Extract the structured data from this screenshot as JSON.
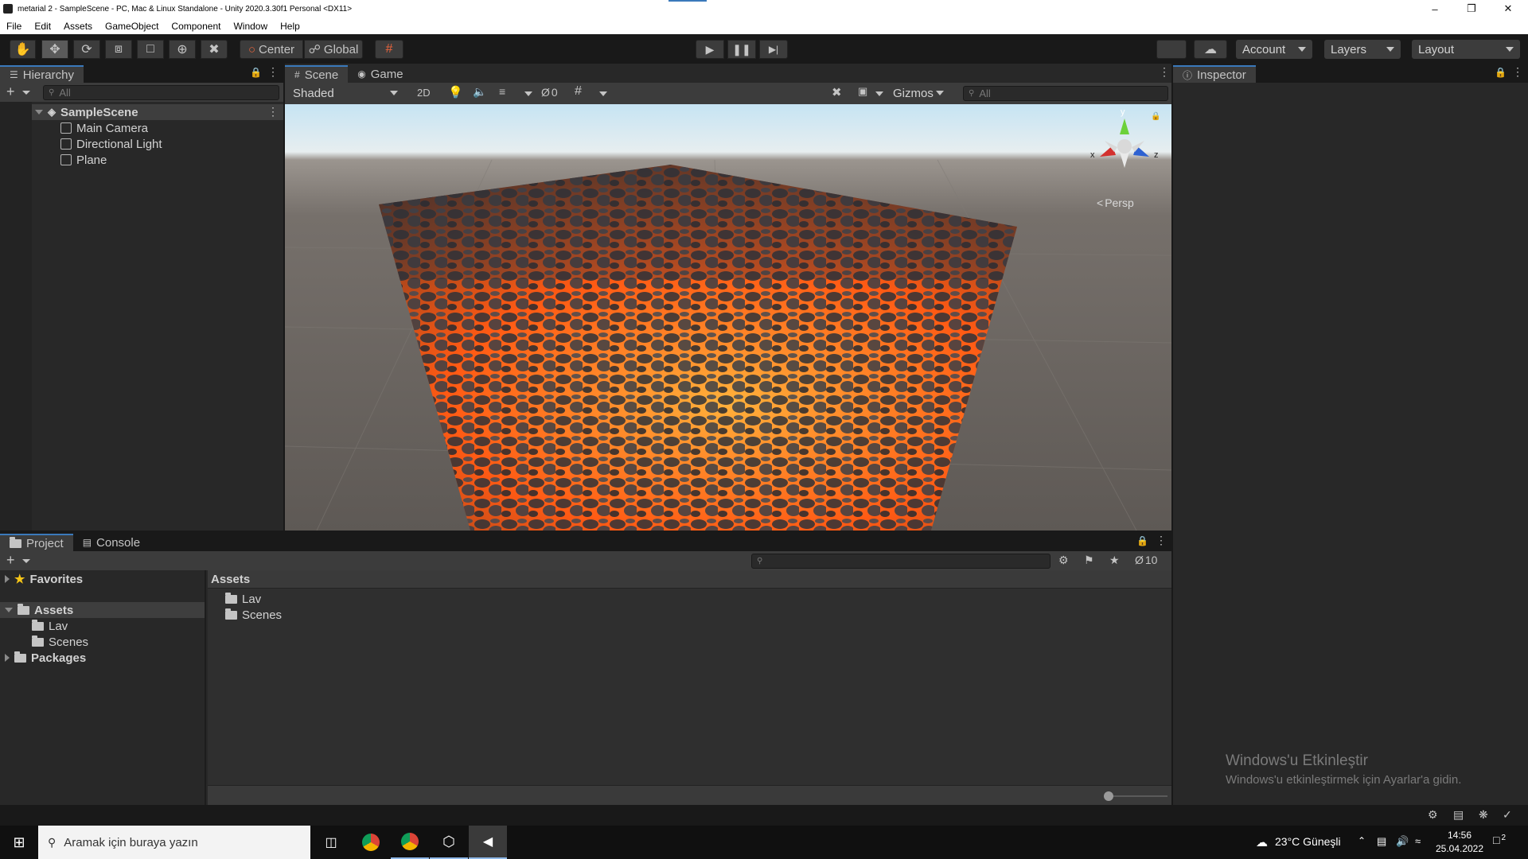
{
  "window": {
    "title": "metarial 2 - SampleScene - PC, Mac & Linux Standalone - Unity 2020.3.30f1 Personal <DX11>"
  },
  "menu": [
    "File",
    "Edit",
    "Assets",
    "GameObject",
    "Component",
    "Window",
    "Help"
  ],
  "toolbar": {
    "pivot_label": "Center",
    "space_label": "Global",
    "account_label": "Account",
    "layers_label": "Layers",
    "layout_label": "Layout"
  },
  "hierarchy": {
    "tab_label": "Hierarchy",
    "search_placeholder": "All",
    "scene_name": "SampleScene",
    "items": [
      "Main Camera",
      "Directional Light",
      "Plane"
    ]
  },
  "scene": {
    "tabs": [
      "Scene",
      "Game"
    ],
    "shading_mode": "Shaded",
    "mode_2d": "2D",
    "hidden_count": "0",
    "gizmos_label": "Gizmos",
    "search_placeholder": "All",
    "projection_label": "Persp",
    "axes": {
      "x": "x",
      "y": "y",
      "z": "z"
    }
  },
  "inspector": {
    "tab_label": "Inspector"
  },
  "project": {
    "tabs": [
      "Project",
      "Console"
    ],
    "hidden_count": "10",
    "tree": {
      "favorites": "Favorites",
      "assets": "Assets",
      "assets_children": [
        "Lav",
        "Scenes"
      ],
      "packages": "Packages"
    },
    "breadcrumb": "Assets",
    "grid_items": [
      "Lav",
      "Scenes"
    ],
    "zoom_slider": 0.0
  },
  "watermark": {
    "line1": "Windows'u Etkinleştir",
    "line2": "Windows'u etkinleştirmek için Ayarlar'a gidin."
  },
  "taskbar": {
    "search_placeholder": "Aramak için buraya yazın",
    "weather": "23°C  Güneşli",
    "time": "14:56",
    "date": "25.04.2022",
    "notification_count": "2"
  },
  "colors": {
    "accent": "#3a79bb",
    "lava": "#ff6a1a",
    "rock": "#2e3238"
  }
}
